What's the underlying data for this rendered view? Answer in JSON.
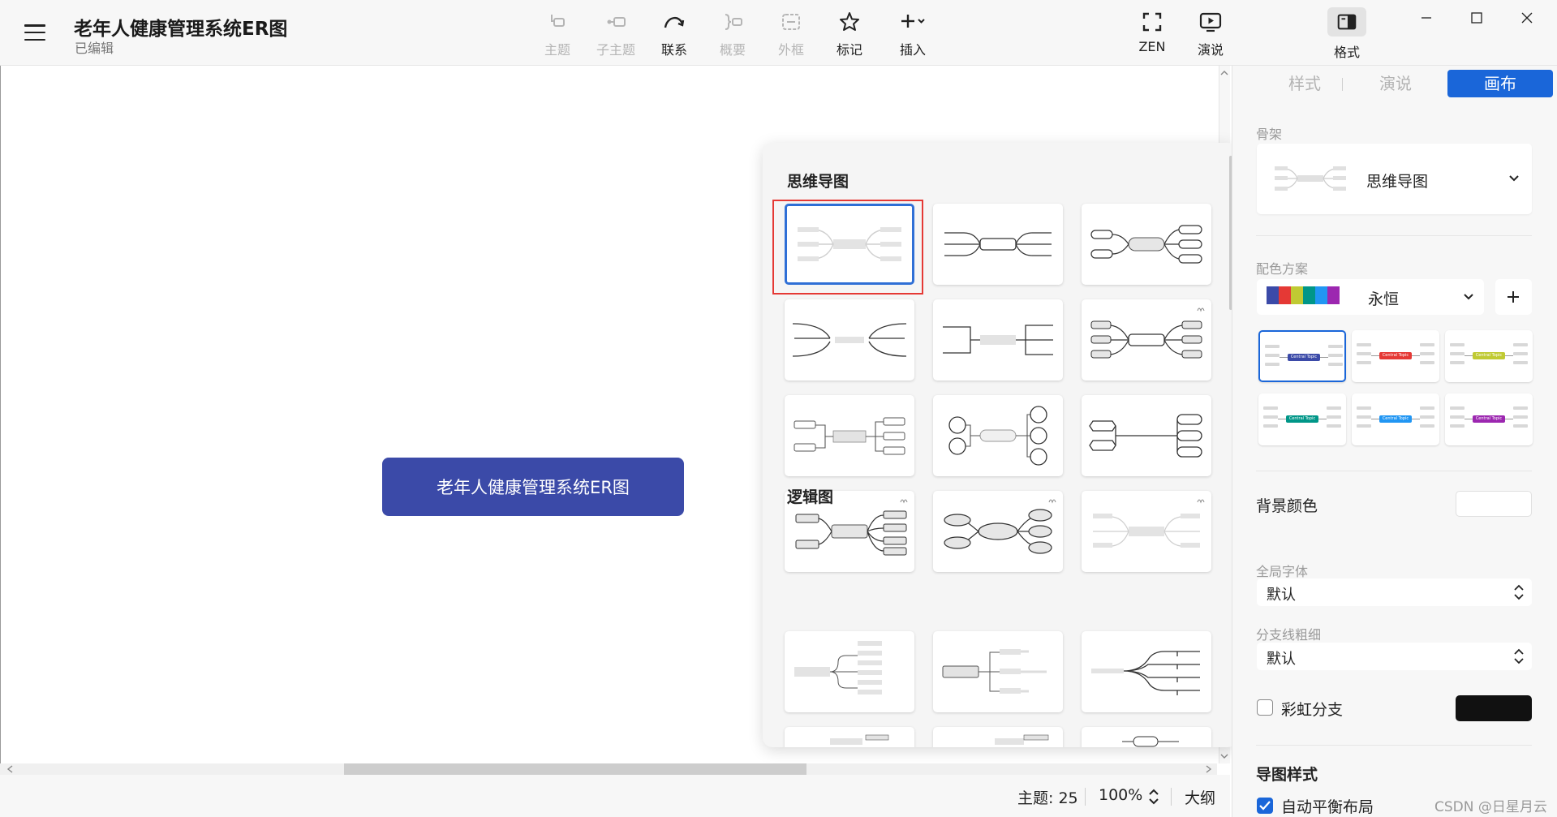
{
  "header": {
    "doc_title": "老年人健康管理系统ER图",
    "doc_status": "已编辑"
  },
  "toolbar": {
    "topic": "主题",
    "subtopic": "子主题",
    "relationship": "联系",
    "summary": "概要",
    "boundary": "外框",
    "marker": "标记",
    "insert": "插入",
    "zen": "ZEN",
    "pitch": "演说",
    "format": "格式"
  },
  "canvas": {
    "central_topic": "老年人健康管理系统ER图"
  },
  "status_bar": {
    "topics_count": "主题: 25",
    "zoom": "100%",
    "outline": "大纲"
  },
  "skeleton_popover": {
    "mindmap_heading": "思维导图",
    "logic_heading": "逻辑图"
  },
  "right_panel": {
    "tabs": [
      "样式",
      "演说",
      "画布"
    ],
    "active_tab": "画布",
    "skeleton_label": "骨架",
    "skeleton_value": "思维导图",
    "color_scheme_label": "配色方案",
    "color_scheme_value": "永恒",
    "color_scheme_swatches": [
      "#3b4aa8",
      "#e53935",
      "#c0ca33",
      "#009688",
      "#2196f3",
      "#9c27b0"
    ],
    "theme_tile_text": "Central Topic",
    "theme_tiles": [
      {
        "color": "#3b4aa8"
      },
      {
        "color": "#e53935"
      },
      {
        "color": "#c0ca33"
      },
      {
        "color": "#009688"
      },
      {
        "color": "#2196f3"
      },
      {
        "color": "#9c27b0"
      }
    ],
    "background_color_label": "背景颜色",
    "global_font_label": "全局字体",
    "global_font_value": "默认",
    "branch_width_label": "分支线粗细",
    "branch_width_value": "默认",
    "rainbow_branch_label": "彩虹分支",
    "map_style_label": "导图样式",
    "auto_balance_label": "自动平衡布局"
  },
  "watermark": "CSDN @日星月云",
  "colors": {
    "accent": "#1a66d9",
    "central_topic": "#3b4aa8",
    "highlight": "#e53935"
  }
}
